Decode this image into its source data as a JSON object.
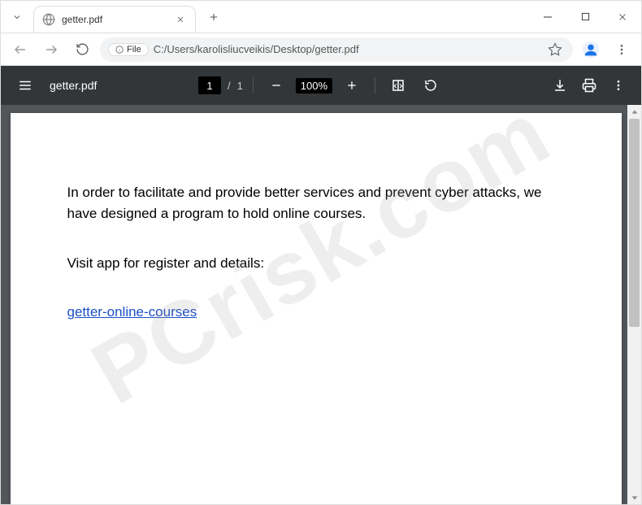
{
  "browser": {
    "tab_title": "getter.pdf",
    "url_scheme_label": "File",
    "url_text": "C:/Users/karolisliucveikis/Desktop/getter.pdf"
  },
  "pdf": {
    "filename": "getter.pdf",
    "current_page": "1",
    "page_separator": "/",
    "total_pages": "1",
    "zoom_level": "100%"
  },
  "document": {
    "paragraph1": "In order to facilitate and provide better services and prevent cyber attacks, we have designed a program to hold online courses.",
    "paragraph2": "Visit app for register and details:",
    "link_text": "getter-online-courses"
  },
  "watermark": "PCrisk.com"
}
